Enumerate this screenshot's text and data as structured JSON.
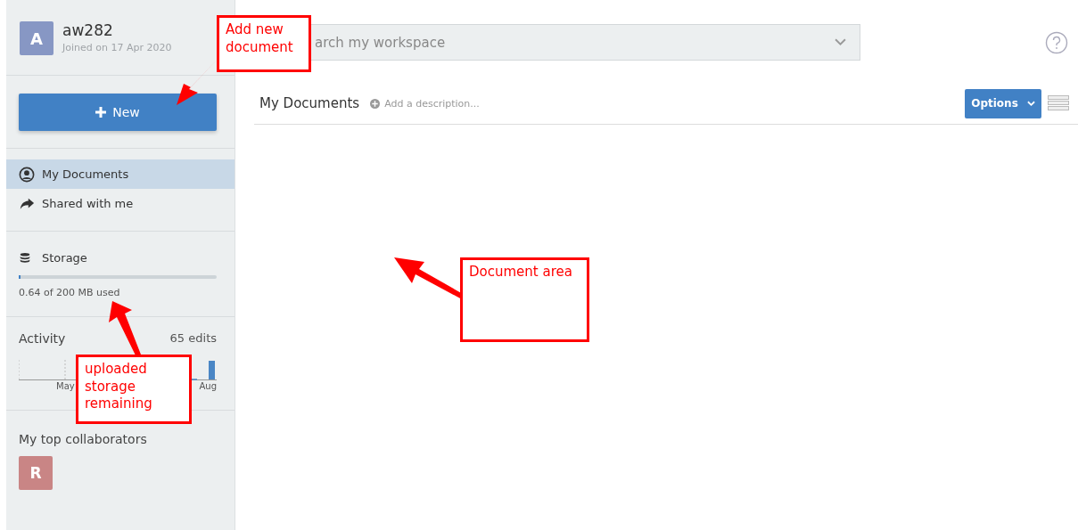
{
  "user": {
    "initial": "A",
    "name": "aw282",
    "joined": "Joined on 17 Apr 2020"
  },
  "new_button": {
    "label": "New"
  },
  "nav": [
    {
      "label": "My Documents",
      "kind": "person",
      "selected": true
    },
    {
      "label": "Shared with me",
      "kind": "share",
      "selected": false
    }
  ],
  "storage": {
    "title": "Storage",
    "level": 0.01,
    "reading": "0.64 of 200 MB used"
  },
  "activity": {
    "title": "Activity",
    "count": "65 edits",
    "x_labels": [
      "May",
      "Aug"
    ]
  },
  "collaborators": {
    "title": "My top collaborators",
    "people": [
      {
        "initial": "R",
        "color": "#c98585"
      }
    ]
  },
  "search": {
    "placeholder": "arch my workspace"
  },
  "header": {
    "title": "My Documents",
    "description_hint": "Add a description...",
    "options": "Options"
  },
  "annotations": [
    {
      "text": "Add new document"
    },
    {
      "text": "Document area"
    },
    {
      "text": "uploaded storage remaining"
    }
  ]
}
